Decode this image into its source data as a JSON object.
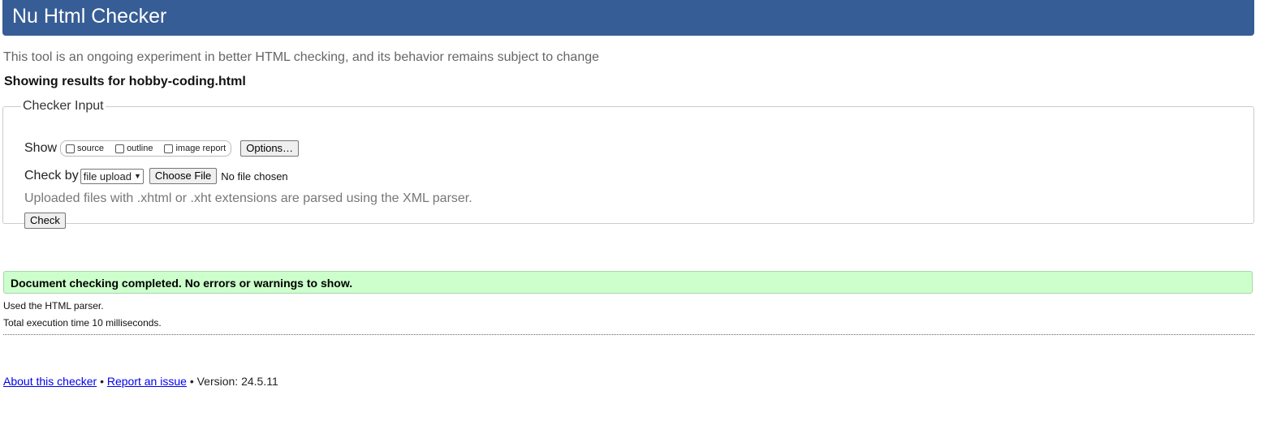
{
  "header": {
    "title": "Nu Html Checker"
  },
  "intro": "This tool is an ongoing experiment in better HTML checking, and its behavior remains subject to change",
  "results_for": "Showing results for hobby-coding.html",
  "checker_input": {
    "legend": "Checker Input",
    "show_label": "Show",
    "show_options": [
      {
        "label": "source",
        "checked": false
      },
      {
        "label": "outline",
        "checked": false
      },
      {
        "label": "image report",
        "checked": false
      }
    ],
    "options_button": "Options…",
    "check_by_label": "Check by",
    "check_by_selected": "file upload",
    "choose_file_button": "Choose File",
    "file_status": "No file chosen",
    "hint": "Uploaded files with .xhtml or .xht extensions are parsed using the XML parser.",
    "check_button": "Check"
  },
  "result": {
    "message": "Document checking completed. No errors or warnings to show.",
    "parser_note": "Used the HTML parser.",
    "execution_time": "Total execution time 10 milliseconds."
  },
  "footer": {
    "about_link": "About this checker",
    "separator": "•",
    "report_link": "Report an issue",
    "version": "Version: 24.5.11"
  },
  "colors": {
    "header_bg": "#365d95",
    "success_bg": "#ccffcc",
    "link": "#0000ee"
  }
}
